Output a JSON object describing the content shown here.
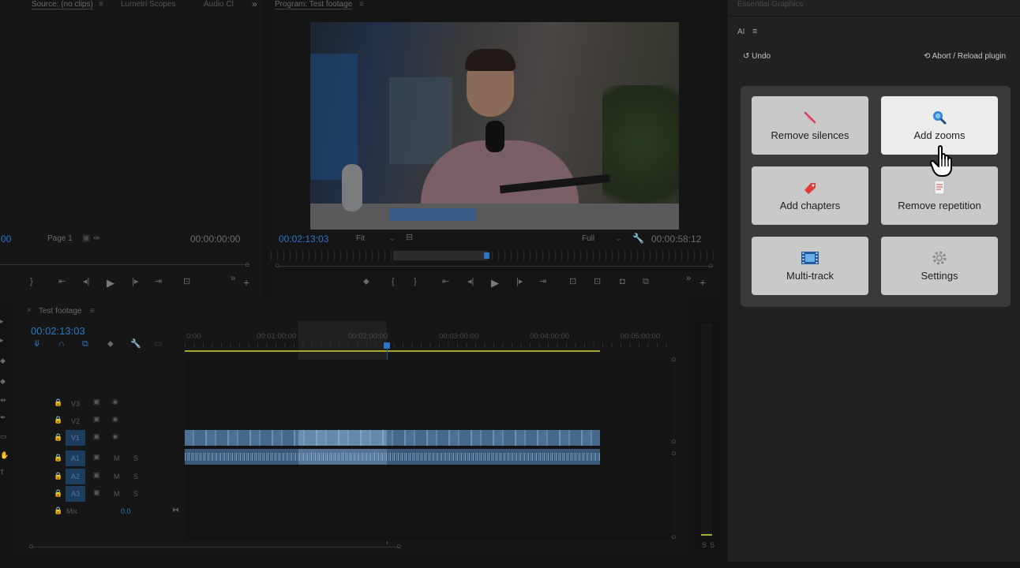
{
  "source_panel": {
    "tabs": [
      "Source: (no clips)",
      "Lumetri Scopes",
      "Audio Cl"
    ],
    "menu_glyph": "≡",
    "more_glyph": "»",
    "timecode_left": "00",
    "page_label": "Page 1",
    "timecode_right": "00:00:00:00"
  },
  "program_panel": {
    "title": "Program: Test footage",
    "menu_glyph": "≡",
    "timecode_current": "00:02:13:03",
    "fit_label": "Fit",
    "full_label": "Full",
    "timecode_duration": "00:00:58:12"
  },
  "timeline": {
    "tab_label": "Test footage",
    "close_glyph": "×",
    "menu_glyph": "≡",
    "timecode": "00:02:13:03",
    "ruler": [
      "0:00",
      "00:01:00:00",
      "00:02:00:00",
      "00:03:00:00",
      "00:04:00:00",
      "00:05:00:00"
    ],
    "video_tracks": [
      "V3",
      "V2",
      "V1"
    ],
    "audio_tracks": [
      "A1",
      "A2",
      "A3"
    ],
    "mute_label": "M",
    "solo_label": "S",
    "mix_label": "Mix",
    "mix_value": "0.0",
    "meter_labels": [
      "S",
      "S"
    ]
  },
  "essential_graphics": {
    "tab": "Essential Graphics",
    "panel_title": "AI",
    "menu_glyph": "≡",
    "undo_label": "Undo",
    "abort_label": "Abort / Reload plugin",
    "cards": [
      {
        "label": "Remove silences",
        "icon": "no-sound-icon"
      },
      {
        "label": "Add zooms",
        "icon": "magnifier-icon"
      },
      {
        "label": "Add chapters",
        "icon": "bookmark-icon"
      },
      {
        "label": "Remove repetition",
        "icon": "document-icon"
      },
      {
        "label": "Multi-track",
        "icon": "film-strip-icon"
      },
      {
        "label": "Settings",
        "icon": "gear-icon"
      }
    ],
    "colors": {
      "accent": "#2a76c4",
      "card": "#c9c9c9",
      "card_hover": "#ececec"
    }
  }
}
